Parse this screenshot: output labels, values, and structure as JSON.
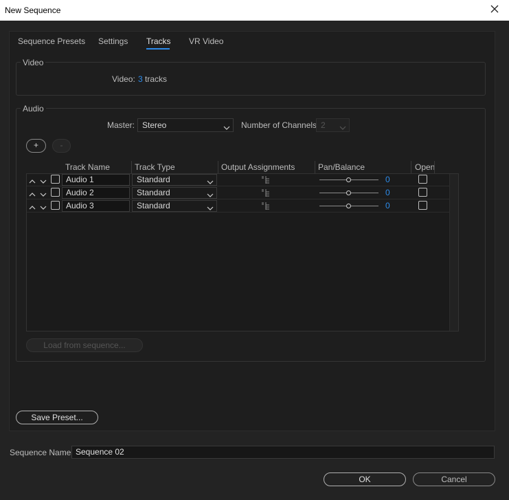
{
  "window": {
    "title": "New Sequence"
  },
  "tabs": [
    {
      "label": "Sequence Presets"
    },
    {
      "label": "Settings"
    },
    {
      "label": "Tracks"
    },
    {
      "label": "VR Video"
    }
  ],
  "video": {
    "section_title": "Video",
    "label": "Video:",
    "count": "3",
    "unit": "tracks"
  },
  "audio": {
    "section_title": "Audio",
    "master_label": "Master:",
    "master_value": "Stereo",
    "channels_label": "Number of Channels:",
    "channels_value": "2",
    "add_label": "+",
    "remove_label": "-",
    "columns": [
      "Track Name",
      "Track Type",
      "Output Assignments",
      "Pan/Balance",
      "Open"
    ],
    "tracks": [
      {
        "name": "Audio 1",
        "type": "Standard",
        "pan": "0",
        "pan_level": 0.5
      },
      {
        "name": "Audio 2",
        "type": "Standard",
        "pan": "0",
        "pan_level": 0.5
      },
      {
        "name": "Audio 3",
        "type": "Standard",
        "pan": "0",
        "pan_level": 0.5
      }
    ],
    "load_label": "Load from sequence..."
  },
  "save_preset_label": "Save Preset...",
  "sequence_name": {
    "label": "Sequence Name:",
    "value": "Sequence 02"
  },
  "ok_label": "OK",
  "cancel_label": "Cancel",
  "colors": {
    "accent": "#2d8ceb",
    "background": "#232323",
    "panel": "#1e1e1e"
  }
}
